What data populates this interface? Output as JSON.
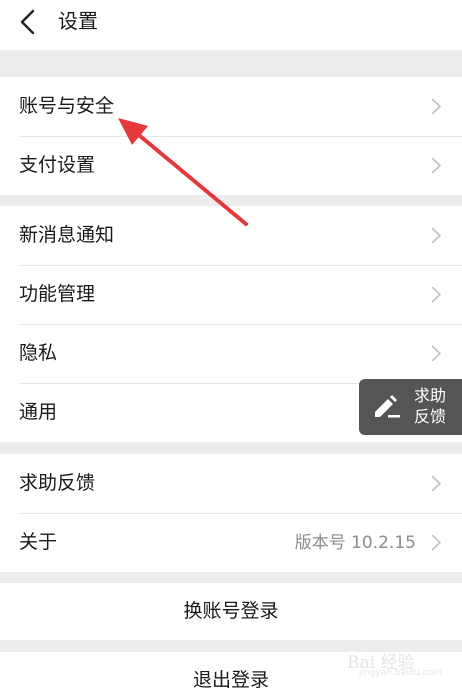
{
  "header": {
    "title": "设置"
  },
  "groups": [
    {
      "items": [
        {
          "label": "账号与安全"
        },
        {
          "label": "支付设置"
        }
      ]
    },
    {
      "items": [
        {
          "label": "新消息通知"
        },
        {
          "label": "功能管理"
        },
        {
          "label": "隐私"
        },
        {
          "label": "通用"
        }
      ]
    },
    {
      "items": [
        {
          "label": "求助反馈"
        },
        {
          "label": "关于",
          "value": "版本号 10.2.15"
        }
      ]
    }
  ],
  "actions": {
    "switch_account": "换账号登录",
    "logout": "退出登录"
  },
  "help_float": {
    "line1": "求助",
    "line2": "反馈"
  },
  "watermark": {
    "text": "Bai 经验",
    "sub": "jingyan.baidu.com"
  },
  "colors": {
    "background": "#ededed",
    "surface": "#ffffff",
    "annotation": "#e5383b",
    "float_button": "#555555"
  },
  "icons": {
    "back": "chevron-left-icon",
    "chevron": "chevron-right-icon",
    "help": "pencil-icon"
  }
}
